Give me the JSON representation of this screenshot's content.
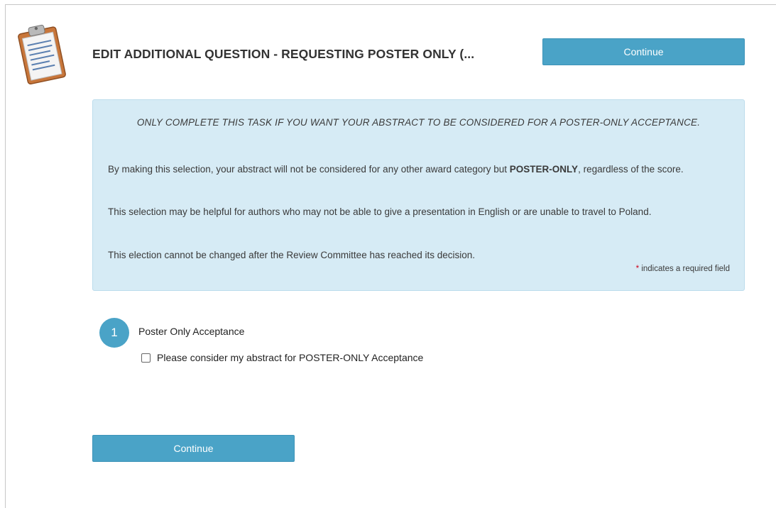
{
  "page": {
    "title": "EDIT ADDITIONAL QUESTION - REQUESTING POSTER ONLY (...",
    "icon": "clipboard-icon"
  },
  "buttons": {
    "continue_top": "Continue",
    "continue_bottom": "Continue"
  },
  "info": {
    "heading": "ONLY COMPLETE THIS TASK IF YOU WANT YOUR ABSTRACT TO BE CONSIDERED FOR A POSTER-ONLY ACCEPTANCE.",
    "p1_before": "By making this selection, your abstract will not be considered for any other award category but ",
    "p1_bold": "POSTER-ONLY",
    "p1_after": ", regardless of the score.",
    "p2": "This selection may be helpful for authors who may not be able to give a presentation in English or are unable to travel to Poland.",
    "p3": "This election cannot be changed after the Review Committee has reached its decision.",
    "required_star": "*",
    "required_note": " indicates a required field"
  },
  "question": {
    "number": "1",
    "label": "Poster Only Acceptance",
    "checkbox_label": "Please consider my abstract for POSTER-ONLY Acceptance",
    "checked": false
  },
  "colors": {
    "accent": "#4aa3c7",
    "info_bg": "#d6ebf5",
    "required": "#d0021b"
  }
}
